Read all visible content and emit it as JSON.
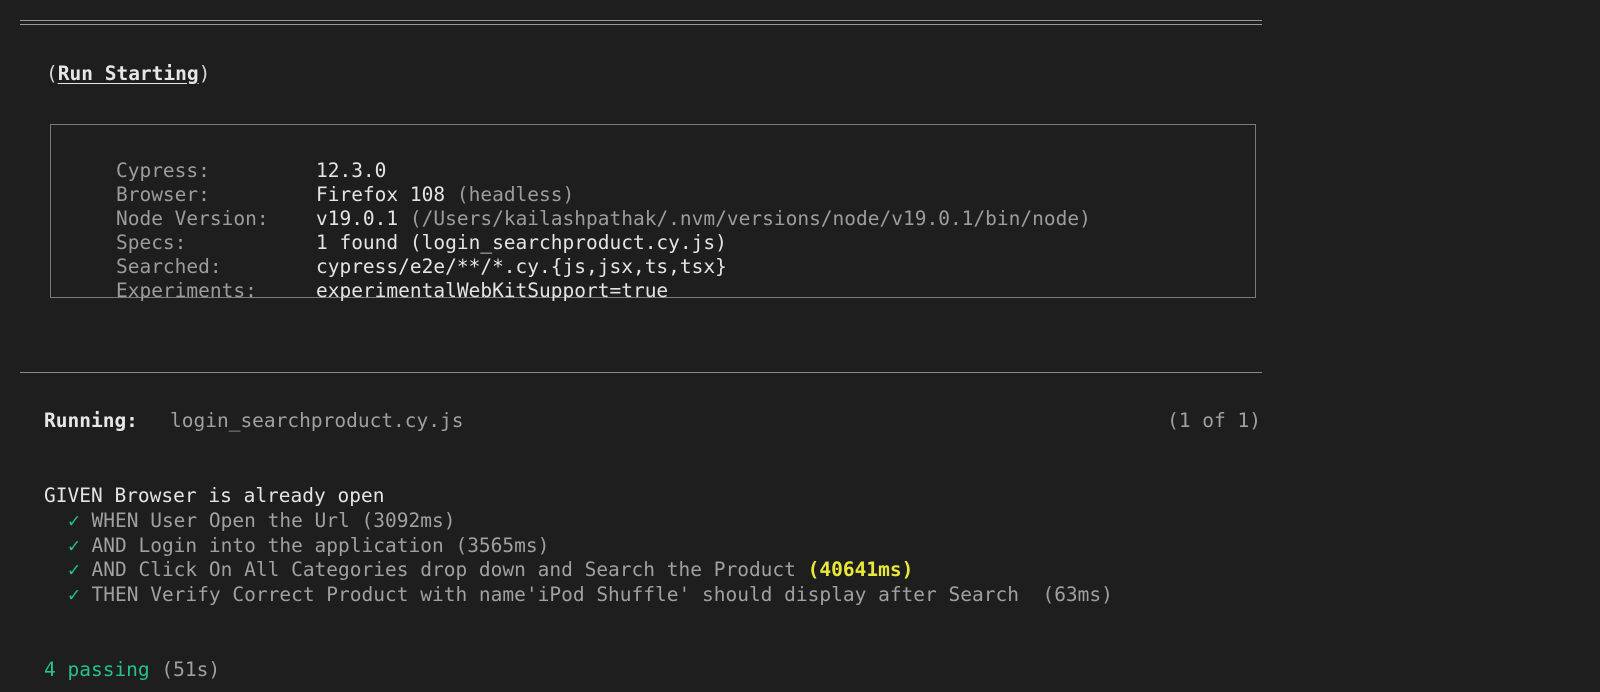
{
  "header": {
    "run_starting_open": "(",
    "run_starting_label": "Run Starting",
    "run_starting_close": ")"
  },
  "info": {
    "rows": [
      {
        "label": "Cypress:",
        "value": "12.3.0",
        "note": ""
      },
      {
        "label": "Browser:",
        "value": "Firefox 108",
        "note": "(headless)"
      },
      {
        "label": "Node Version:",
        "value": "v19.0.1",
        "note": "(/Users/kailashpathak/.nvm/versions/node/v19.0.1/bin/node)"
      },
      {
        "label": "Specs:",
        "value": "1 found (login_searchproduct.cy.js)",
        "note": ""
      },
      {
        "label": "Searched:",
        "value": "cypress/e2e/**/*.cy.{js,jsx,ts,tsx}",
        "note": ""
      },
      {
        "label": "Experiments:",
        "value": "experimentalWebKitSupport=true",
        "note": ""
      }
    ]
  },
  "running": {
    "label": "Running:",
    "spec": "login_searchproduct.cy.js",
    "count": "(1 of 1)"
  },
  "suite": {
    "title": "GIVEN Browser is already open",
    "check_glyph": "✓",
    "tests": [
      {
        "title": "WHEN User Open the Url",
        "duration": "(3092ms)",
        "slow": false
      },
      {
        "title": "AND Login into the application",
        "duration": "(3565ms)",
        "slow": false
      },
      {
        "title": "AND Click On All Categories drop down and Search the Product",
        "duration": "(40641ms)",
        "slow": true
      },
      {
        "title": "THEN Verify Correct Product with name'iPod Shuffle' should display after Search ",
        "duration": "(63ms)",
        "slow": false
      }
    ]
  },
  "summary": {
    "passing": "4 passing",
    "time": "(51s)"
  },
  "colors": {
    "background": "#1e1e1e",
    "pass_green": "#22c28a",
    "slow_yellow": "#e8e83a",
    "dim_gray": "#9c9c9c"
  }
}
